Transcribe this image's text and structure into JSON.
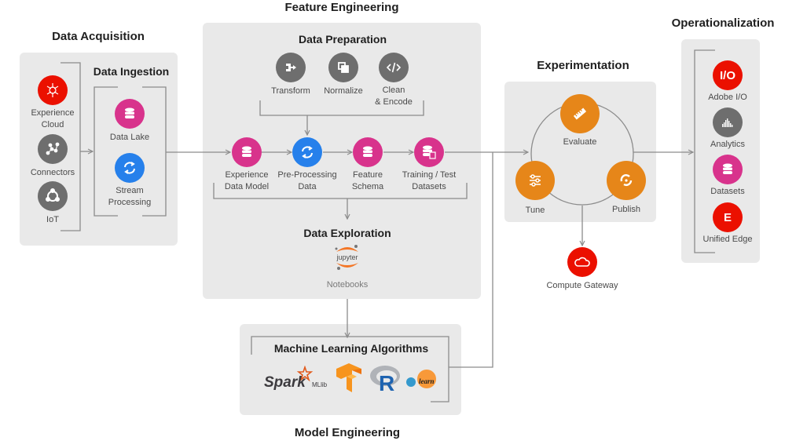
{
  "stages": {
    "data_acquisition": "Data Acquisition",
    "feature_engineering": "Feature Engineering",
    "experimentation": "Experimentation",
    "operationalization": "Operationalization",
    "model_engineering": "Model Engineering"
  },
  "acquisition": {
    "sources": [
      {
        "label": "Experience Cloud",
        "line1": "Experience",
        "line2": "Cloud",
        "icon": "experience-cloud-icon",
        "color": "#eb1000"
      },
      {
        "label": "Connectors",
        "icon": "connectors-icon",
        "color": "#6e6e6e"
      },
      {
        "label": "IoT",
        "icon": "iot-icon",
        "color": "#6e6e6e"
      }
    ],
    "ingestion_title": "Data Ingestion",
    "ingestion": [
      {
        "label": "Data Lake",
        "icon": "database-icon",
        "color": "#d8338c"
      },
      {
        "label": "Stream Processing",
        "line1": "Stream",
        "line2": "Processing",
        "icon": "sync-icon",
        "color": "#2680eb"
      }
    ]
  },
  "feature_engineering": {
    "preparation_title": "Data Preparation",
    "preparation": [
      {
        "label": "Transform",
        "icon": "transform-icon",
        "color": "#6e6e6e"
      },
      {
        "label": "Normalize",
        "icon": "normalize-icon",
        "color": "#6e6e6e"
      },
      {
        "label": "Clean & Encode",
        "line1": "Clean",
        "line2": "& Encode",
        "icon": "code-icon",
        "color": "#6e6e6e"
      }
    ],
    "pipeline": [
      {
        "label": "Experience Data Model",
        "line1": "Experience",
        "line2": "Data Model",
        "icon": "database-icon",
        "color": "#d8338c"
      },
      {
        "label": "Pre-Processing Data",
        "line1": "Pre-Processing",
        "line2": "Data",
        "icon": "sync-icon",
        "color": "#2680eb"
      },
      {
        "label": "Feature Schema",
        "line1": "Feature",
        "line2": "Schema",
        "icon": "database-icon",
        "color": "#d8338c"
      },
      {
        "label": "Training / Test Datasets",
        "line1": "Training / Test",
        "line2": "Datasets",
        "icon": "dataset-icon",
        "color": "#d8338c"
      }
    ],
    "exploration_title": "Data Exploration",
    "exploration_logo": "jupyter",
    "exploration_label": "Notebooks"
  },
  "model_engineering": {
    "title": "Machine Learning Algorithms",
    "libraries": [
      {
        "name": "Spark",
        "suffix": "MLlib"
      },
      {
        "name": "TensorFlow"
      },
      {
        "name": "R"
      },
      {
        "name": "scikit-learn",
        "text": "learn"
      }
    ]
  },
  "experimentation": {
    "cycle": [
      {
        "label": "Evaluate",
        "icon": "ruler-icon",
        "color": "#e68619"
      },
      {
        "label": "Tune",
        "icon": "sliders-icon",
        "color": "#e68619"
      },
      {
        "label": "Publish",
        "icon": "publish-icon",
        "color": "#e68619"
      }
    ],
    "gateway": {
      "label": "Compute Gateway",
      "icon": "cloud-icon",
      "color": "#eb1000"
    }
  },
  "operationalization": {
    "targets": [
      {
        "label": "Adobe I/O",
        "glyph": "I/O",
        "color": "#eb1000"
      },
      {
        "label": "Analytics",
        "icon": "analytics-icon",
        "color": "#6e6e6e"
      },
      {
        "label": "Datasets",
        "icon": "database-icon",
        "color": "#d8338c"
      },
      {
        "label": "Unified Edge",
        "glyph": "E",
        "color": "#eb1000"
      }
    ]
  },
  "colors": {
    "panel": "#e9e9e9",
    "line": "#8c8c8c",
    "red": "#eb1000",
    "magenta": "#d8338c",
    "blue": "#2680eb",
    "gray": "#6e6e6e",
    "orange": "#e68619"
  }
}
